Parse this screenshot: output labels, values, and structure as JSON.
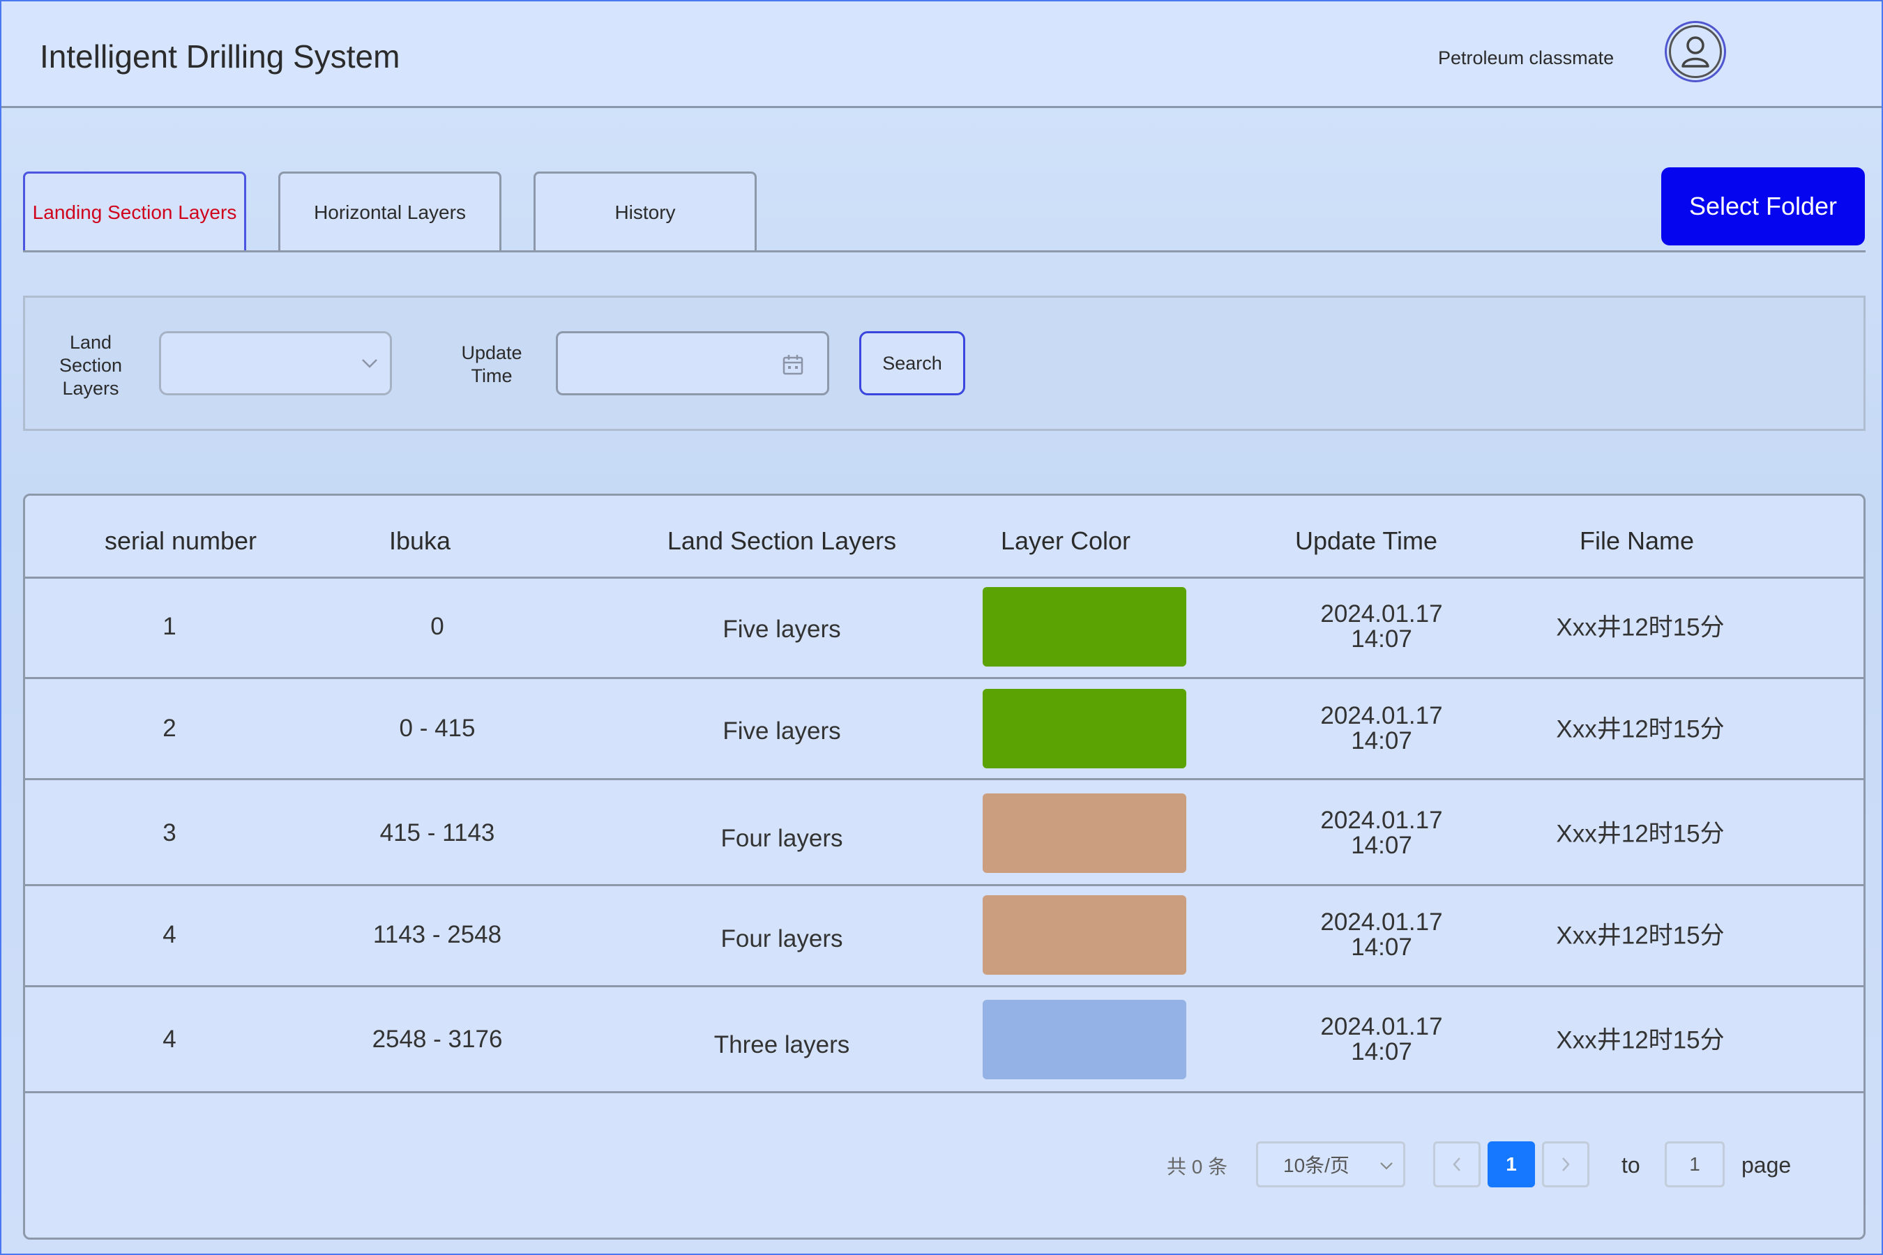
{
  "header": {
    "title": "Intelligent Drilling System",
    "user_name": "Petroleum classmate"
  },
  "tabs": [
    {
      "label": "Landing Section Layers",
      "active": true
    },
    {
      "label": "Horizontal Layers",
      "active": false
    },
    {
      "label": "History",
      "active": false
    }
  ],
  "select_folder_label": "Select Folder",
  "filters": {
    "layer_label": "Land Section Layers",
    "layer_label_lines": [
      "Land",
      "Section",
      "Layers"
    ],
    "layer_value": "",
    "time_label_lines": [
      "Update",
      "Time"
    ],
    "time_value": "",
    "search_label": "Search"
  },
  "table": {
    "columns": [
      "serial number",
      "Ibuka",
      "Land Section Layers",
      "Layer Color",
      "Update Time",
      "File Name"
    ],
    "rows": [
      {
        "serial": "1",
        "depth": "0",
        "layers": "Five layers",
        "color": "#5ba203",
        "date": "2024.01.17",
        "time": "14:07",
        "file": "Xxx井12时15分"
      },
      {
        "serial": "2",
        "depth": "0 - 415",
        "layers": "Five layers",
        "color": "#5ba203",
        "date": "2024.01.17",
        "time": "14:07",
        "file": "Xxx井12时15分"
      },
      {
        "serial": "3",
        "depth": "415 - 1143",
        "layers": "Four layers",
        "color": "#cc9e80",
        "date": "2024.01.17",
        "time": "14:07",
        "file": "Xxx井12时15分"
      },
      {
        "serial": "4",
        "depth": "1143 - 2548",
        "layers": "Four layers",
        "color": "#cc9e80",
        "date": "2024.01.17",
        "time": "14:07",
        "file": "Xxx井12时15分"
      },
      {
        "serial": "4",
        "depth": "2548 - 3176",
        "layers": "Three layers",
        "color": "#94b2e6",
        "date": "2024.01.17",
        "time": "14:07",
        "file": "Xxx井12时15分"
      }
    ]
  },
  "pagination": {
    "total": "共 0 条",
    "page_size": "10条/页",
    "current_page": "1",
    "goto_prefix": "to",
    "goto_value": "1",
    "goto_suffix": "page"
  },
  "colors": {
    "accent_blue": "#0505ef",
    "active_tab_text": "#d0021b",
    "page_active": "#1677ff"
  },
  "icons": [
    "user-avatar-icon",
    "chevron-down-icon",
    "calendar-icon",
    "chevron-left-icon",
    "chevron-right-icon"
  ]
}
